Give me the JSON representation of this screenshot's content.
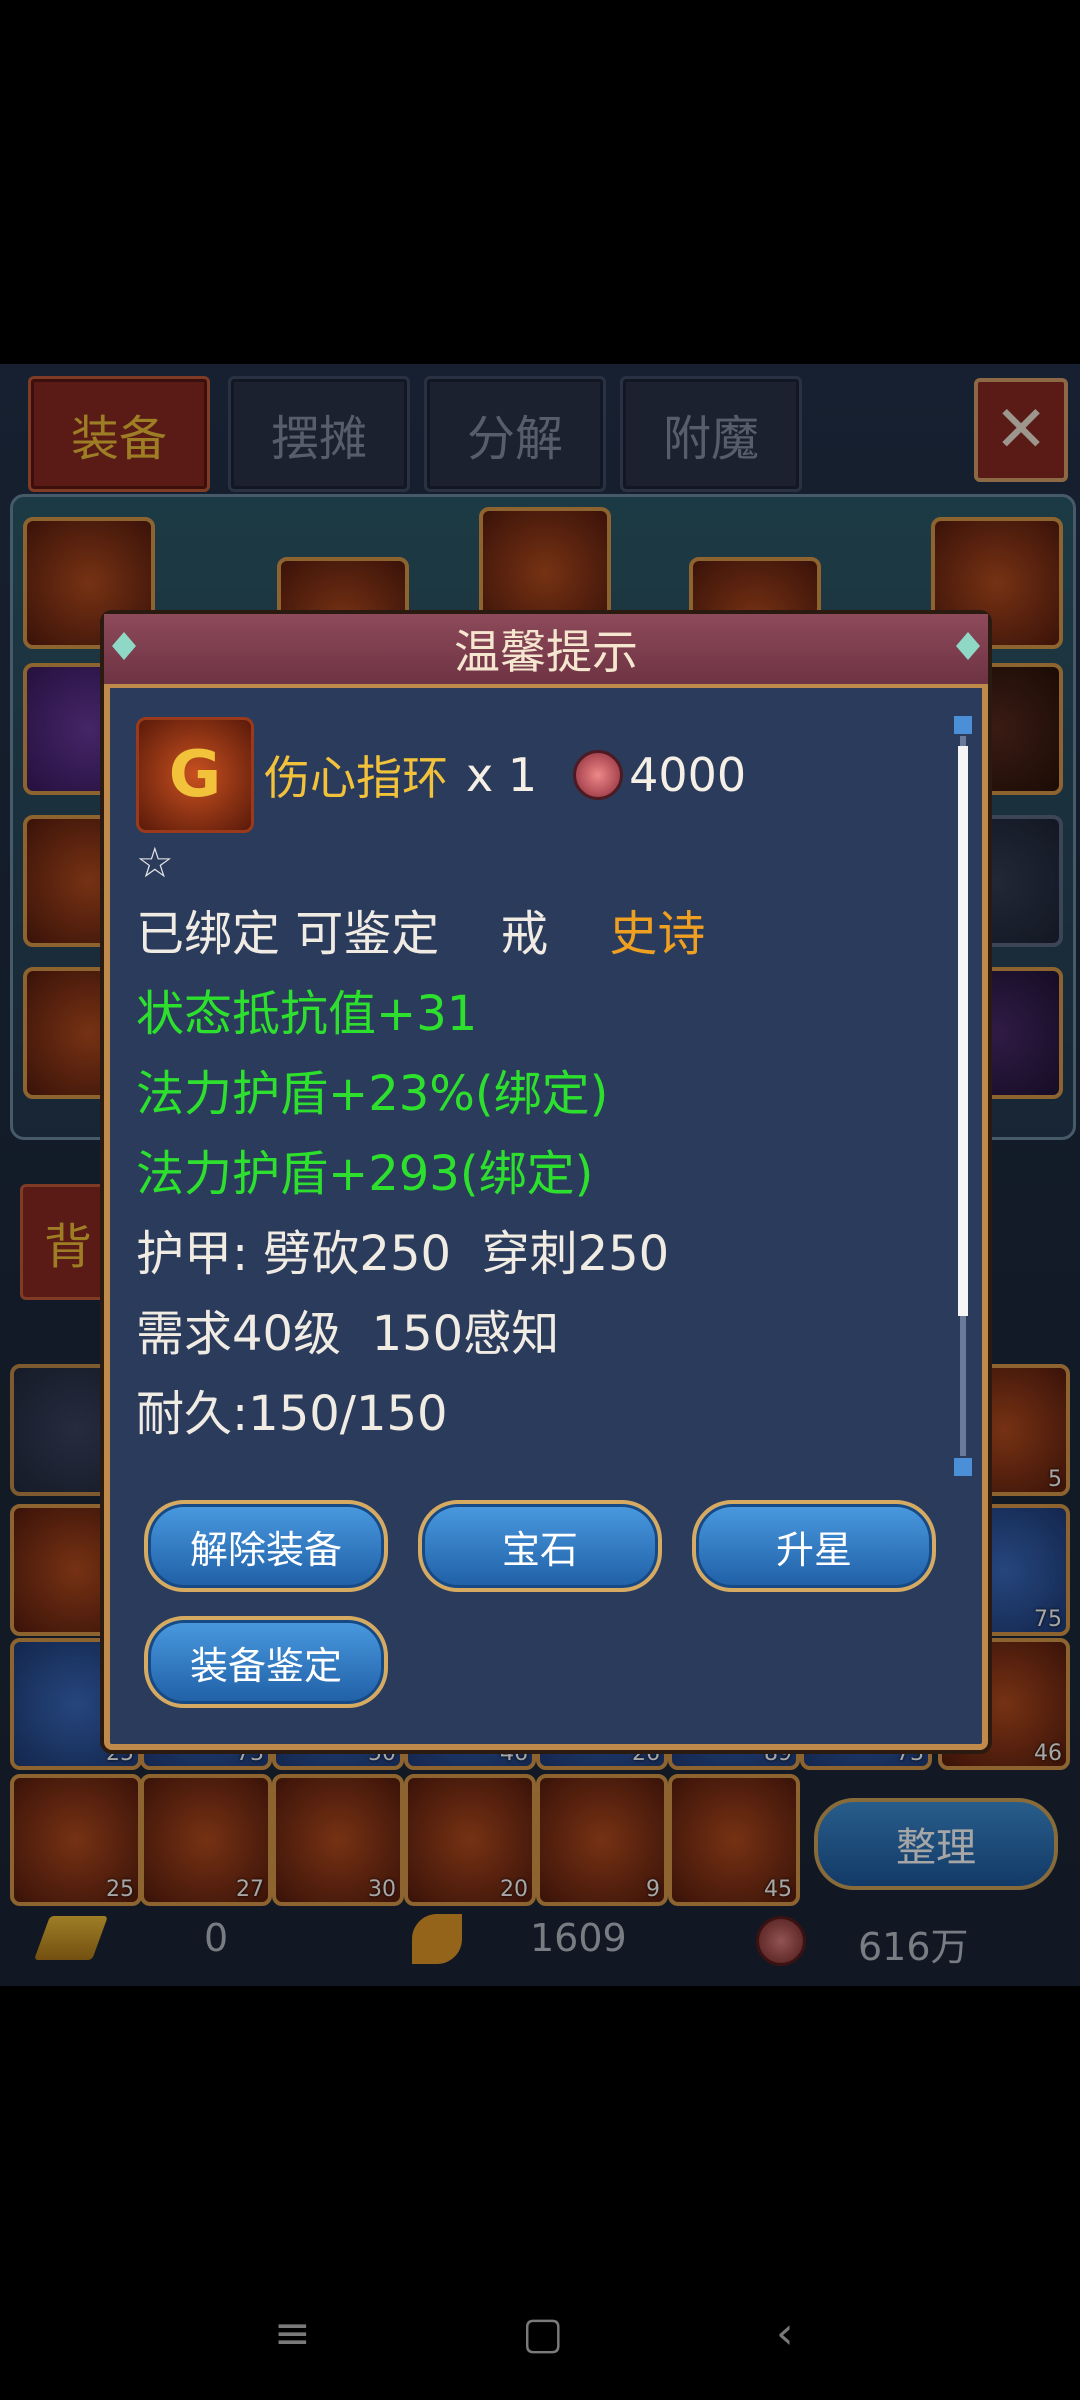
{
  "tabs": [
    {
      "label": "装备",
      "active": true
    },
    {
      "label": "摆摊",
      "active": false
    },
    {
      "label": "分解",
      "active": false
    },
    {
      "label": "附魔",
      "active": false
    }
  ],
  "bag_tab_label": "背",
  "bag_counts": [
    "5",
    "75",
    "25",
    "73",
    "50",
    "46",
    "26",
    "89",
    "73",
    "46",
    "25",
    "27",
    "30",
    "20",
    "9",
    "45"
  ],
  "sort_button": "整理",
  "currency": {
    "gold": "0",
    "leaf": "1609",
    "coin": "616万"
  },
  "dialog": {
    "title": "温馨提示",
    "item": {
      "name": "伤心指环",
      "count": "x 1",
      "price": "4000",
      "stars": "☆"
    },
    "lines": [
      {
        "parts": [
          {
            "text": "已绑定 可鉴定    戒    ",
            "color": "white"
          },
          {
            "text": "史诗",
            "color": "orange"
          }
        ]
      },
      {
        "parts": [
          {
            "text": "状态抵抗值+31",
            "color": "green"
          }
        ]
      },
      {
        "parts": [
          {
            "text": "法力护盾+23%(绑定)",
            "color": "green"
          }
        ]
      },
      {
        "parts": [
          {
            "text": "法力护盾+293(绑定)",
            "color": "green"
          }
        ]
      },
      {
        "parts": [
          {
            "text": "护甲: 劈砍250  穿刺250",
            "color": "white"
          }
        ]
      },
      {
        "parts": [
          {
            "text": "需求40级  150感知",
            "color": "white"
          }
        ]
      },
      {
        "parts": [
          {
            "text": "耐久:150/150",
            "color": "white"
          }
        ]
      }
    ],
    "buttons": {
      "unequip": "解除装备",
      "gem": "宝石",
      "upgrade": "升星",
      "identify": "装备鉴定"
    }
  },
  "nav": {
    "menu": "≡",
    "home": "▢",
    "back": "‹"
  }
}
